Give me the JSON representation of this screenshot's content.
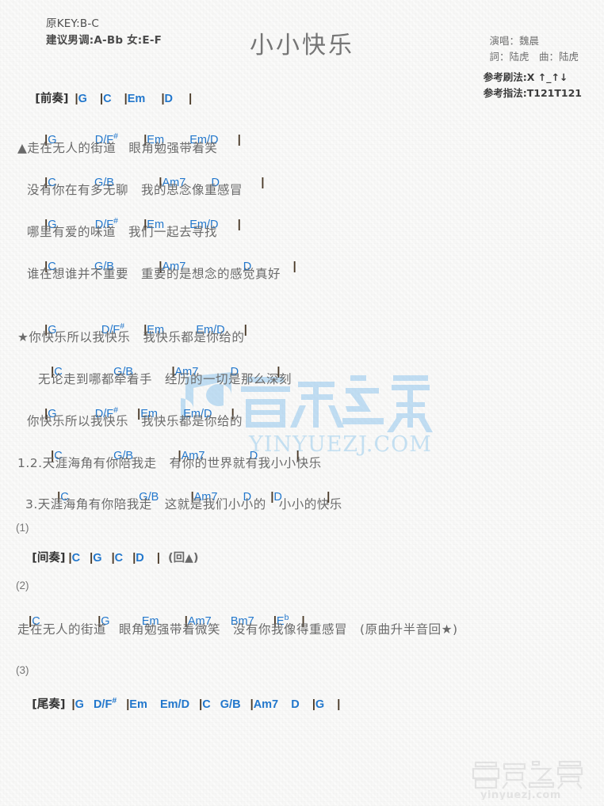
{
  "header": {
    "title": "小小快乐",
    "original_key": "原KEY:B-C",
    "suggested_key": "建议男调:A-Bb 女:E-F",
    "singer": "演唱：魏晨",
    "writer": "詞：陆虎　曲：陆虎",
    "strum": "参考刷法:X ↑_↑↓",
    "fingering": "参考指法:T121T121"
  },
  "sections": {
    "intro": {
      "tag": "[前奏]",
      "chords": "|G    |C    |Em    |D    |"
    },
    "verse1": {
      "line1_chords": "|G            D/F#        |Em        Em/D      |",
      "line1_lyric": "▲走在无人的街道　眼角勉强带着笑",
      "line2_chords": "|C            G/B            |Am7        D              |",
      "line2_lyric": "没有你在有多无聊　我的思念像重感冒",
      "line3_chords": "|G            D/F#        |Em        Em/D      |",
      "line3_lyric": "哪里有爱的味道　我们一起去寻找",
      "line4_chords": "|C            G/B            |Am7                D              |",
      "line4_lyric": "谁在想谁并不重要　重要的是想念的感觉真好"
    },
    "chorus": {
      "line1_chords": "|G              D/F#      |Em          Em/D      |",
      "line1_lyric": "★你快乐所以我快乐　我快乐都是你给的",
      "line2_chords": "|C                G/B          |Am7          D            |",
      "line2_lyric": "无论走到哪都牵着手　经历的一切是那么深刻",
      "line3_chords": "|G            D/F#      |Em        Em/D      |",
      "line3_lyric": "你快乐所以我快乐　我快乐都是你给的",
      "line4_chords": "|C              G/B            |Am7            D            |",
      "line4_lyric": "1.2.天涯海角有你陪我走　有你的世界就有我小小快乐",
      "line5_chords": "|C                G/B            |Am7        D        |D            |",
      "line5_lyric": "3.天涯海角有你陪我走　这就是我们小小的　小小的快乐"
    },
    "interlude": {
      "number": "(1)",
      "tag": "[间奏]",
      "chords": "|C    |G    |C    |D    |",
      "repeat_note": "(回▲)"
    },
    "bridge": {
      "number": "(2)",
      "chords": "|C                |G          Em        |Am7      Bm7      |Eb    |",
      "lyric": "走在无人的街道　眼角勉强带着微笑　没有你我像得重感冒　",
      "note": "(原曲升半音回★)"
    },
    "outro": {
      "number": "(3)",
      "tag": "[尾奏]",
      "chords": "|G   D/F#   |Em    Em/D   |C   G/B   |Am7    D    |G    |"
    }
  },
  "watermarks": {
    "center_text_cn": "音乐之家",
    "center_text_en": "YINYUEZJ.COM",
    "bottom_text_cn": "音乐之家",
    "bottom_text_en": "yinyuezj.com"
  },
  "colors": {
    "chord_blue": "#2277cc",
    "lyric_gray": "#6a6a6a",
    "barline": "#4a3a28",
    "paper": "#f7f7f6",
    "watermark_blue": "#8fc4ec"
  }
}
